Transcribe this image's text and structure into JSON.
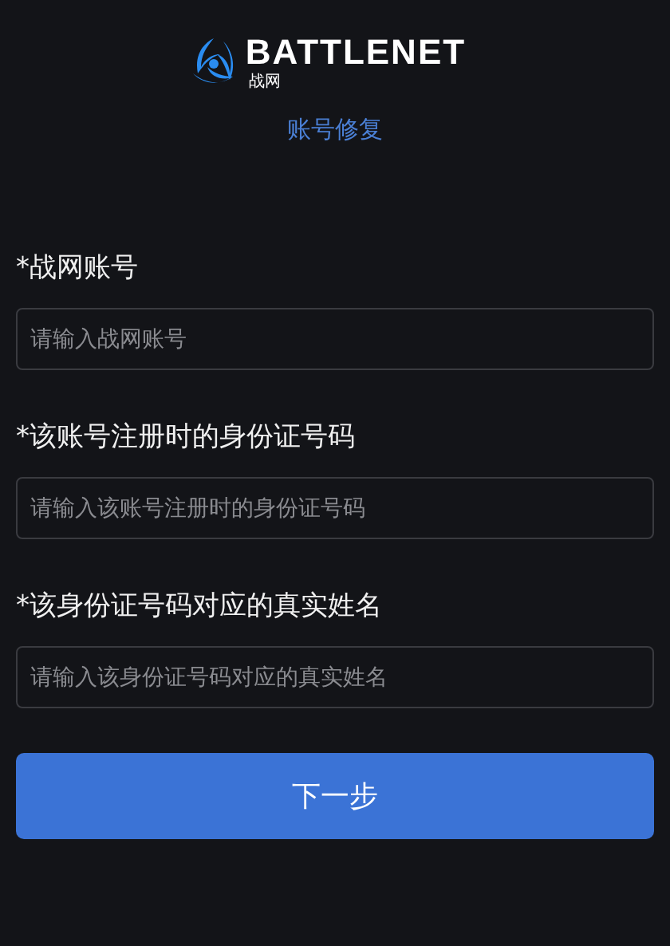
{
  "logo": {
    "wordmark": "BATTLENET",
    "sub": "战网"
  },
  "title": "账号修复",
  "fields": [
    {
      "label": "*战网账号",
      "placeholder": "请输入战网账号"
    },
    {
      "label": "*该账号注册时的身份证号码",
      "placeholder": "请输入该账号注册时的身份证号码"
    },
    {
      "label": "*该身份证号码对应的真实姓名",
      "placeholder": "请输入该身份证号码对应的真实姓名"
    }
  ],
  "button": "下一步"
}
